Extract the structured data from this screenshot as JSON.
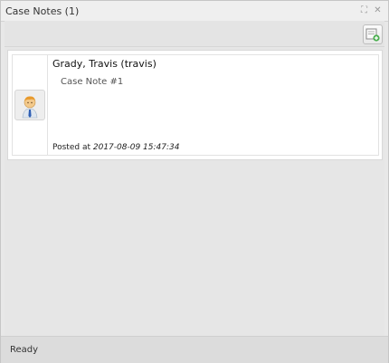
{
  "window": {
    "title": "Case Notes (1)"
  },
  "toolbar": {
    "add_note_icon": "add-note-icon"
  },
  "notes": [
    {
      "author": "Grady, Travis (travis)",
      "text": "Case Note #1",
      "posted_label": "Posted at",
      "posted_time": "2017-08-09 15:47:34",
      "avatar_icon": "user-avatar-icon"
    }
  ],
  "status": {
    "text": "Ready"
  },
  "colors": {
    "accent_green": "#4caf50",
    "header_bg": "#efefef"
  }
}
